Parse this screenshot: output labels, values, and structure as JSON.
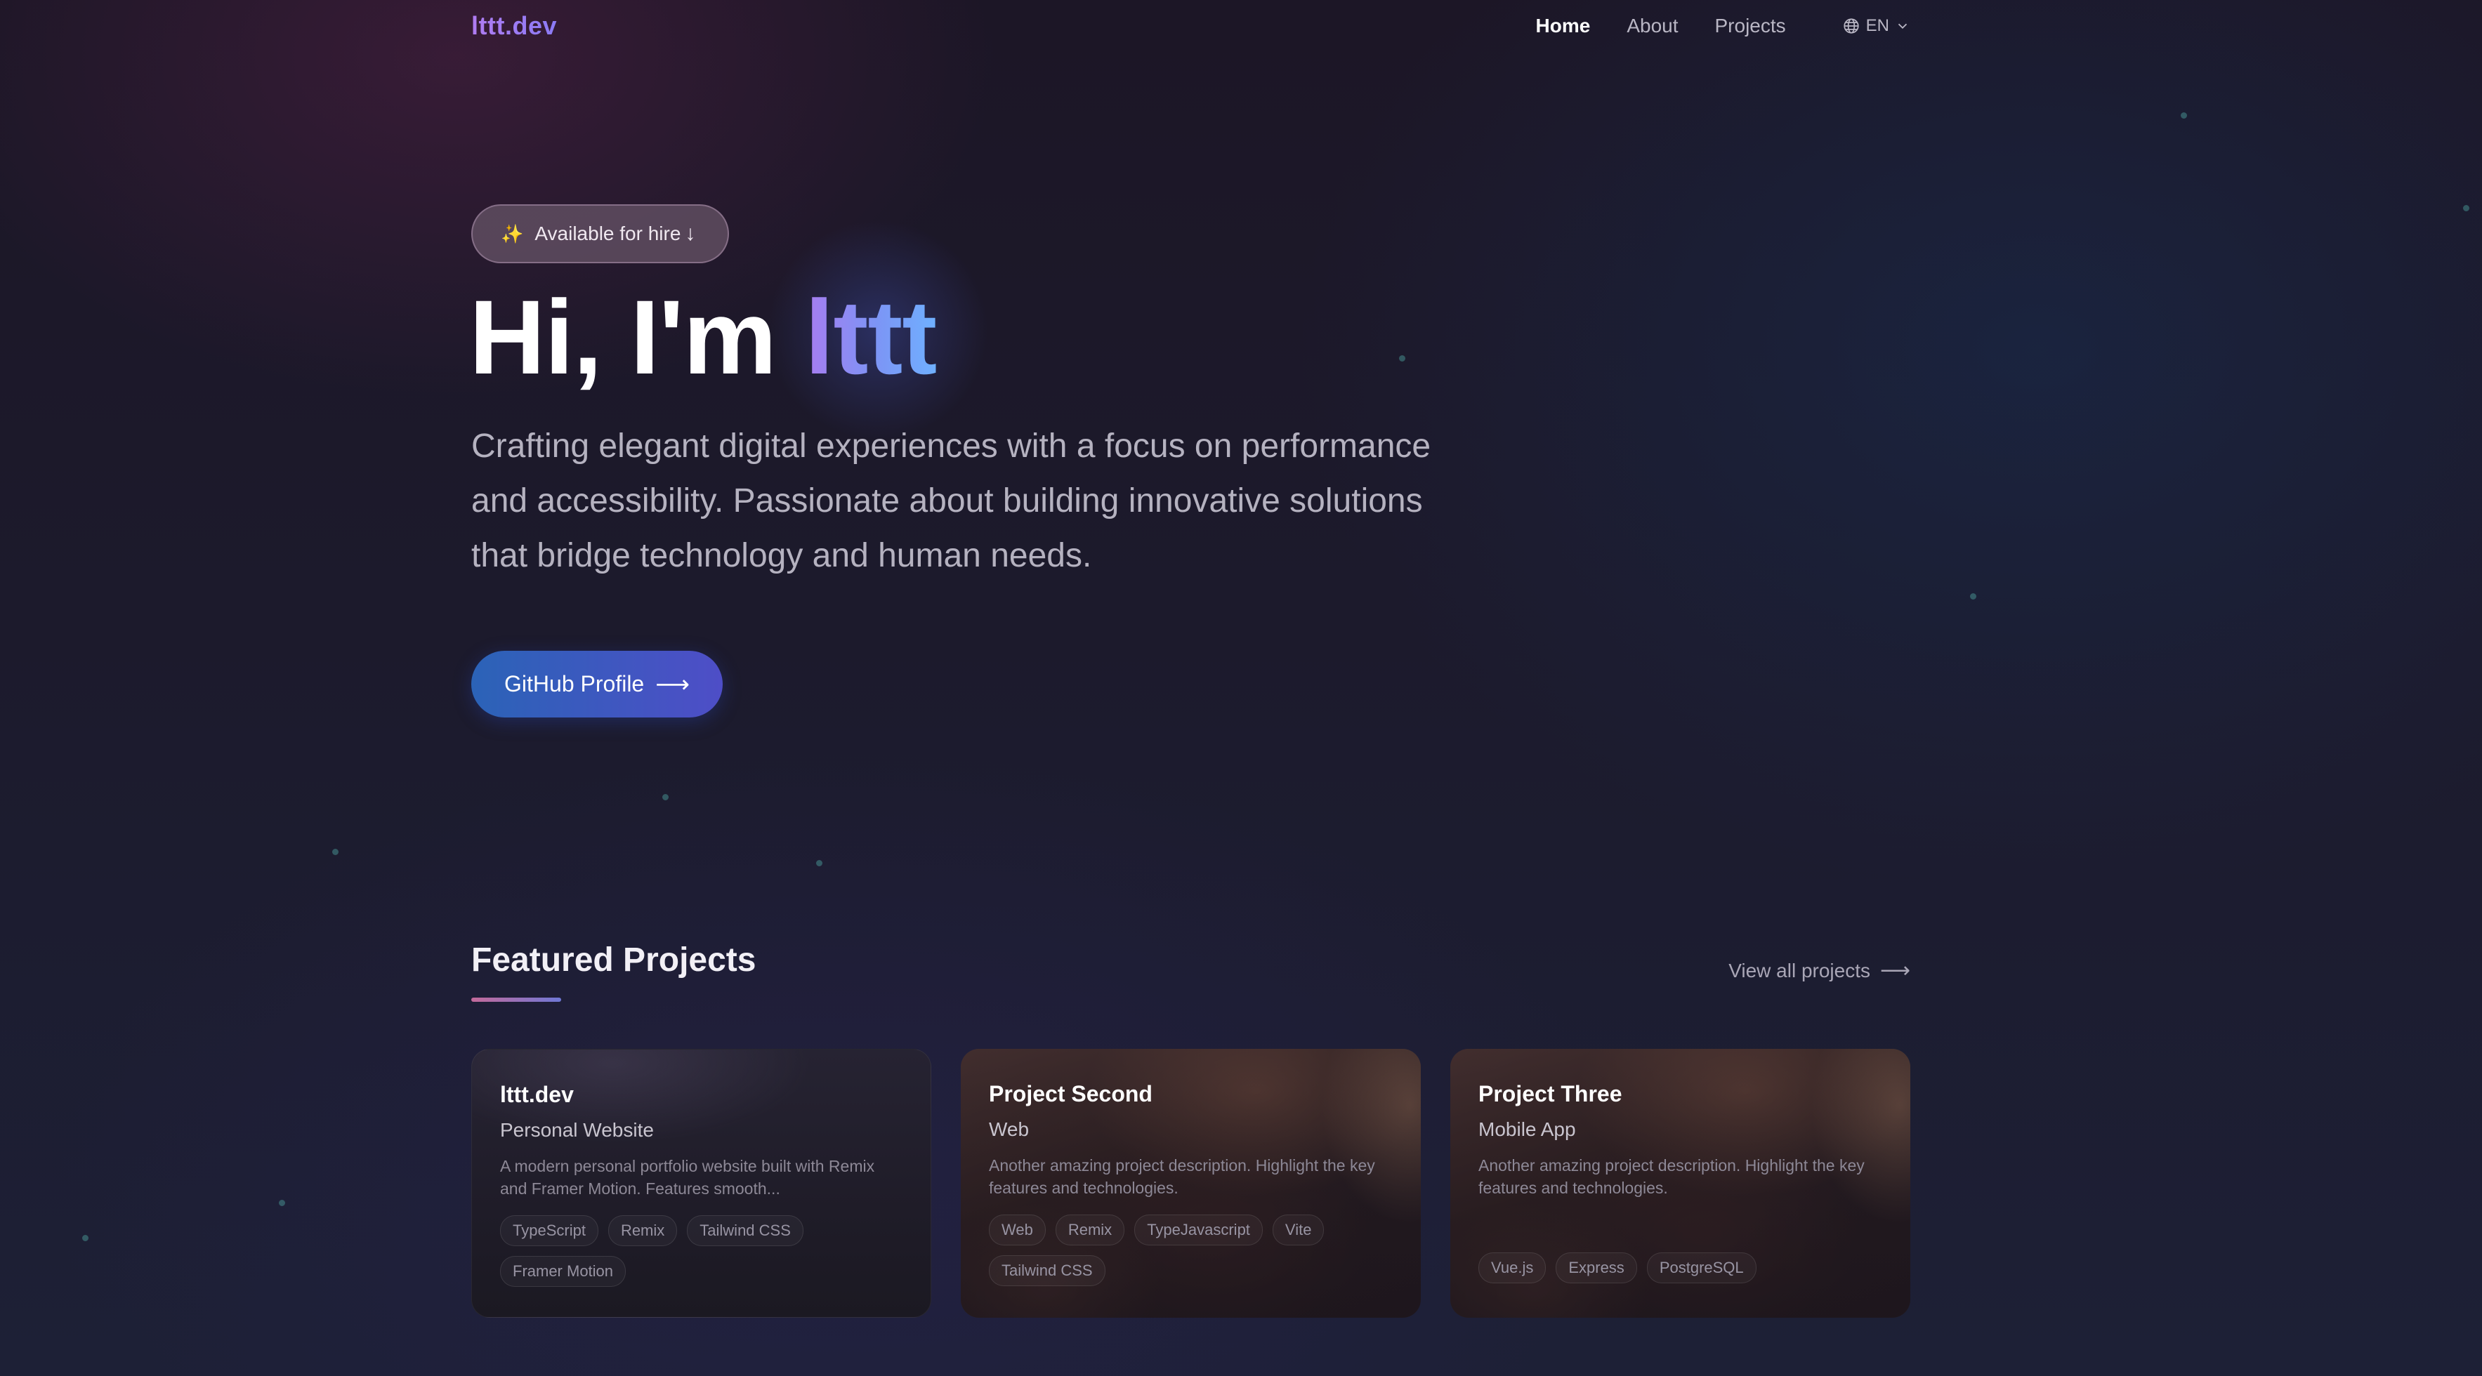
{
  "nav": {
    "logo": "lttt.dev",
    "links": [
      "Home",
      "About",
      "Projects"
    ],
    "active_link": "Home",
    "language": "EN",
    "globe_icon": "globe-icon",
    "chevron_icon": "chevron-down-icon"
  },
  "hero": {
    "badge_text": "Available for hire",
    "badge_icon": "sparkles-icon",
    "badge_arrow": "arrow-down-icon",
    "title_prefix": "Hi, I'm ",
    "title_name": "lttt",
    "description": "Crafting elegant digital experiences with a focus on performance and accessibility. Passionate about building innovative solutions that bridge technology and human needs.",
    "cta_label": "GitHub Profile",
    "cta_icon": "arrow-right-icon"
  },
  "featured": {
    "title": "Featured Projects",
    "view_all_label": "View all projects",
    "view_all_icon": "arrow-right-icon",
    "projects": [
      {
        "title": "lttt.dev",
        "subtitle": "Personal Website",
        "description": "A modern personal portfolio website built with Remix and Framer Motion. Features smooth...",
        "tags": [
          "TypeScript",
          "Remix",
          "Tailwind CSS",
          "Framer Motion"
        ]
      },
      {
        "title": "Project Second",
        "subtitle": "Web",
        "description": "Another amazing project description. Highlight the key features and technologies.",
        "tags": [
          "Web",
          "Remix",
          "TypeJavascript",
          "Vite",
          "Tailwind CSS"
        ]
      },
      {
        "title": "Project Three",
        "subtitle": "Mobile App",
        "description": "Another amazing project description. Highlight the key features and technologies.",
        "tags": [
          "Vue.js",
          "Express",
          "PostgreSQL"
        ]
      }
    ]
  },
  "colors": {
    "accent_purple": "#a77cf0",
    "accent_blue": "#6fb0ff",
    "button_start": "#2b63b7",
    "button_end": "#4e4ec7",
    "background": "#1c1a2c"
  }
}
